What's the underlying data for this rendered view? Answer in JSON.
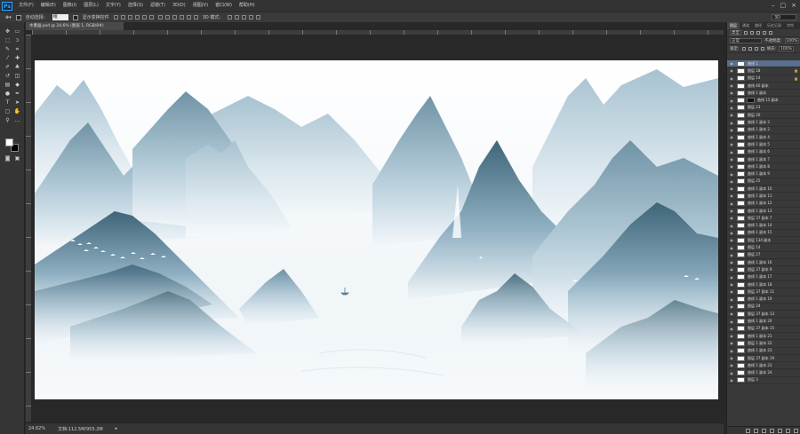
{
  "app": {
    "logo": "Ps"
  },
  "menu": [
    "文件(F)",
    "编辑(E)",
    "图像(I)",
    "图层(L)",
    "文字(Y)",
    "选择(S)",
    "滤镜(T)",
    "3D(D)",
    "视图(V)",
    "窗口(W)",
    "帮助(H)"
  ],
  "window_controls": [
    "–",
    "□",
    "×"
  ],
  "options": {
    "auto_select_label": "自动选择：",
    "auto_select_value": "组",
    "transform_label": "显示变换控件",
    "mode_3d_label": "3D 模式：",
    "workspace": "3D"
  },
  "document": {
    "tab_title": "水墨画.psd @ 24.6% (图层 1, RGB/8#)",
    "zoom": "24.62%",
    "doc_info": "文档:112.5M/955.2M"
  },
  "panel": {
    "tabs": [
      "图层",
      "通道",
      "路径",
      "历史记录",
      "字符"
    ],
    "kind_label": "类型",
    "blend_mode": "正常",
    "opacity_label": "不透明度:",
    "opacity_value": "100%",
    "lock_label": "锁定:",
    "fill_label": "填充:",
    "fill_value": "100%"
  },
  "layers": [
    {
      "name": "曲线 1",
      "selected": true
    },
    {
      "name": "图层 18",
      "lock": true
    },
    {
      "name": "图层 14",
      "lock": true
    },
    {
      "name": "曲线 40 副本"
    },
    {
      "name": "曲线 1 副本"
    },
    {
      "name": "曲线 15 副本",
      "mask": true
    },
    {
      "name": "图层 23"
    },
    {
      "name": "图层 26"
    },
    {
      "name": "曲线 1 副本 3"
    },
    {
      "name": "曲线 1 副本 2"
    },
    {
      "name": "曲线 1 副本 4"
    },
    {
      "name": "曲线 1 副本 5"
    },
    {
      "name": "曲线 1 副本 6"
    },
    {
      "name": "曲线 1 副本 7"
    },
    {
      "name": "曲线 1 副本 8"
    },
    {
      "name": "曲线 1 副本 9"
    },
    {
      "name": "图层 25"
    },
    {
      "name": "曲线 1 副本 10"
    },
    {
      "name": "曲线 1 副本 11"
    },
    {
      "name": "曲线 1 副本 12"
    },
    {
      "name": "曲线 1 副本 13"
    },
    {
      "name": "图层 37 副本 7"
    },
    {
      "name": "曲线 1 副本 14"
    },
    {
      "name": "曲线 1 副本 15"
    },
    {
      "name": "图层 134 副本"
    },
    {
      "name": "图层 14"
    },
    {
      "name": "图层 27"
    },
    {
      "name": "曲线 1 副本 16"
    },
    {
      "name": "图层 37 副本 9"
    },
    {
      "name": "曲线 1 副本 17"
    },
    {
      "name": "曲线 1 副本 18"
    },
    {
      "name": "图层 37 副本 11"
    },
    {
      "name": "曲线 1 副本 19"
    },
    {
      "name": "图层 24"
    },
    {
      "name": "图层 37 副本 13"
    },
    {
      "name": "曲线 1 副本 20"
    },
    {
      "name": "图层 37 副本 15"
    },
    {
      "name": "曲线 1 副本 21"
    },
    {
      "name": "图层 1 副本 22"
    },
    {
      "name": "曲线 1 副本 23"
    },
    {
      "name": "图层 37 副本 19"
    },
    {
      "name": "曲线 1 副本 23"
    },
    {
      "name": "曲线 1 副本 24"
    },
    {
      "name": "图层 3"
    }
  ],
  "colors": {
    "accent": "#31a8ff",
    "selected_layer": "#5a6f8c",
    "ink_dark": "#3f6578",
    "ink_light": "#a7c2d0"
  }
}
